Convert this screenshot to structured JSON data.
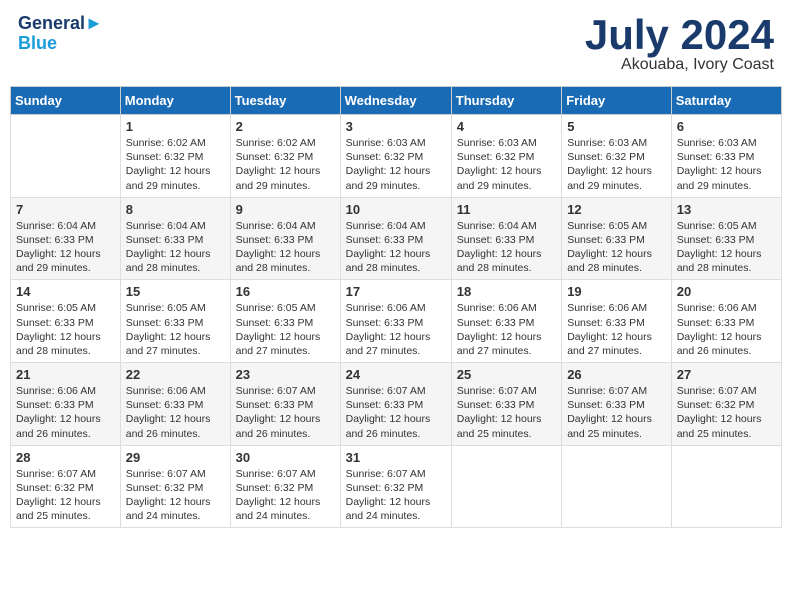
{
  "header": {
    "logo_line1": "General",
    "logo_line2": "Blue",
    "month_year": "July 2024",
    "location": "Akouaba, Ivory Coast"
  },
  "days_of_week": [
    "Sunday",
    "Monday",
    "Tuesday",
    "Wednesday",
    "Thursday",
    "Friday",
    "Saturday"
  ],
  "weeks": [
    [
      {
        "day": "",
        "info": ""
      },
      {
        "day": "1",
        "info": "Sunrise: 6:02 AM\nSunset: 6:32 PM\nDaylight: 12 hours\nand 29 minutes."
      },
      {
        "day": "2",
        "info": "Sunrise: 6:02 AM\nSunset: 6:32 PM\nDaylight: 12 hours\nand 29 minutes."
      },
      {
        "day": "3",
        "info": "Sunrise: 6:03 AM\nSunset: 6:32 PM\nDaylight: 12 hours\nand 29 minutes."
      },
      {
        "day": "4",
        "info": "Sunrise: 6:03 AM\nSunset: 6:32 PM\nDaylight: 12 hours\nand 29 minutes."
      },
      {
        "day": "5",
        "info": "Sunrise: 6:03 AM\nSunset: 6:32 PM\nDaylight: 12 hours\nand 29 minutes."
      },
      {
        "day": "6",
        "info": "Sunrise: 6:03 AM\nSunset: 6:33 PM\nDaylight: 12 hours\nand 29 minutes."
      }
    ],
    [
      {
        "day": "7",
        "info": "Sunrise: 6:04 AM\nSunset: 6:33 PM\nDaylight: 12 hours\nand 29 minutes."
      },
      {
        "day": "8",
        "info": "Sunrise: 6:04 AM\nSunset: 6:33 PM\nDaylight: 12 hours\nand 28 minutes."
      },
      {
        "day": "9",
        "info": "Sunrise: 6:04 AM\nSunset: 6:33 PM\nDaylight: 12 hours\nand 28 minutes."
      },
      {
        "day": "10",
        "info": "Sunrise: 6:04 AM\nSunset: 6:33 PM\nDaylight: 12 hours\nand 28 minutes."
      },
      {
        "day": "11",
        "info": "Sunrise: 6:04 AM\nSunset: 6:33 PM\nDaylight: 12 hours\nand 28 minutes."
      },
      {
        "day": "12",
        "info": "Sunrise: 6:05 AM\nSunset: 6:33 PM\nDaylight: 12 hours\nand 28 minutes."
      },
      {
        "day": "13",
        "info": "Sunrise: 6:05 AM\nSunset: 6:33 PM\nDaylight: 12 hours\nand 28 minutes."
      }
    ],
    [
      {
        "day": "14",
        "info": "Sunrise: 6:05 AM\nSunset: 6:33 PM\nDaylight: 12 hours\nand 28 minutes."
      },
      {
        "day": "15",
        "info": "Sunrise: 6:05 AM\nSunset: 6:33 PM\nDaylight: 12 hours\nand 27 minutes."
      },
      {
        "day": "16",
        "info": "Sunrise: 6:05 AM\nSunset: 6:33 PM\nDaylight: 12 hours\nand 27 minutes."
      },
      {
        "day": "17",
        "info": "Sunrise: 6:06 AM\nSunset: 6:33 PM\nDaylight: 12 hours\nand 27 minutes."
      },
      {
        "day": "18",
        "info": "Sunrise: 6:06 AM\nSunset: 6:33 PM\nDaylight: 12 hours\nand 27 minutes."
      },
      {
        "day": "19",
        "info": "Sunrise: 6:06 AM\nSunset: 6:33 PM\nDaylight: 12 hours\nand 27 minutes."
      },
      {
        "day": "20",
        "info": "Sunrise: 6:06 AM\nSunset: 6:33 PM\nDaylight: 12 hours\nand 26 minutes."
      }
    ],
    [
      {
        "day": "21",
        "info": "Sunrise: 6:06 AM\nSunset: 6:33 PM\nDaylight: 12 hours\nand 26 minutes."
      },
      {
        "day": "22",
        "info": "Sunrise: 6:06 AM\nSunset: 6:33 PM\nDaylight: 12 hours\nand 26 minutes."
      },
      {
        "day": "23",
        "info": "Sunrise: 6:07 AM\nSunset: 6:33 PM\nDaylight: 12 hours\nand 26 minutes."
      },
      {
        "day": "24",
        "info": "Sunrise: 6:07 AM\nSunset: 6:33 PM\nDaylight: 12 hours\nand 26 minutes."
      },
      {
        "day": "25",
        "info": "Sunrise: 6:07 AM\nSunset: 6:33 PM\nDaylight: 12 hours\nand 25 minutes."
      },
      {
        "day": "26",
        "info": "Sunrise: 6:07 AM\nSunset: 6:33 PM\nDaylight: 12 hours\nand 25 minutes."
      },
      {
        "day": "27",
        "info": "Sunrise: 6:07 AM\nSunset: 6:32 PM\nDaylight: 12 hours\nand 25 minutes."
      }
    ],
    [
      {
        "day": "28",
        "info": "Sunrise: 6:07 AM\nSunset: 6:32 PM\nDaylight: 12 hours\nand 25 minutes."
      },
      {
        "day": "29",
        "info": "Sunrise: 6:07 AM\nSunset: 6:32 PM\nDaylight: 12 hours\nand 24 minutes."
      },
      {
        "day": "30",
        "info": "Sunrise: 6:07 AM\nSunset: 6:32 PM\nDaylight: 12 hours\nand 24 minutes."
      },
      {
        "day": "31",
        "info": "Sunrise: 6:07 AM\nSunset: 6:32 PM\nDaylight: 12 hours\nand 24 minutes."
      },
      {
        "day": "",
        "info": ""
      },
      {
        "day": "",
        "info": ""
      },
      {
        "day": "",
        "info": ""
      }
    ]
  ]
}
